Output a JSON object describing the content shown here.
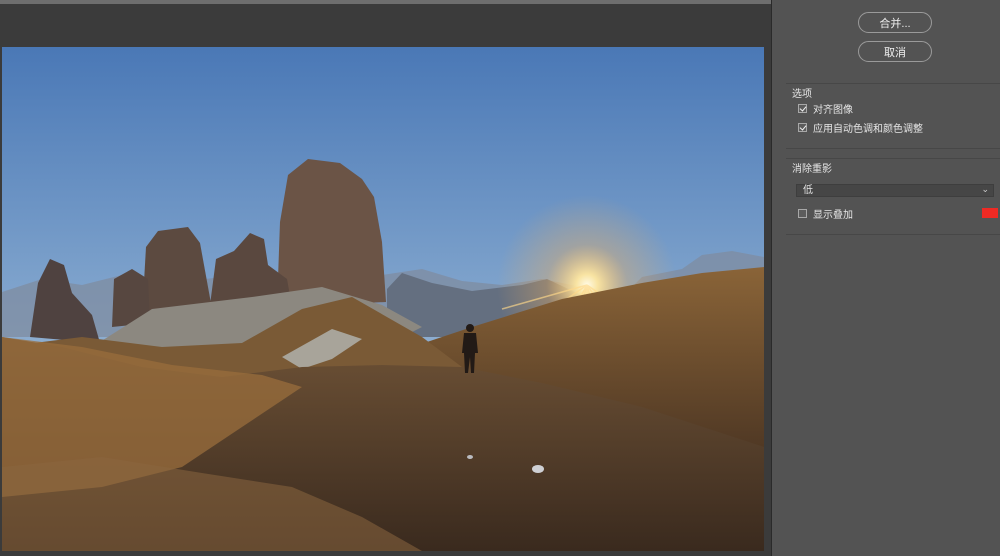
{
  "buttons": {
    "merge_label": "合并...",
    "cancel_label": "取消"
  },
  "options": {
    "title": "选项",
    "align_images": {
      "label": "对齐图像",
      "checked": true
    },
    "auto_tone_color": {
      "label": "应用自动色调和颜色调整",
      "checked": true
    }
  },
  "ghost_removal": {
    "title": "消除重影",
    "level_selected": "低",
    "show_overlay": {
      "label": "显示叠加",
      "checked": false
    },
    "overlay_color": "#ee2a24"
  },
  "colors": {
    "panel_bg": "#535353",
    "preview_bg": "#3b3b3b"
  }
}
